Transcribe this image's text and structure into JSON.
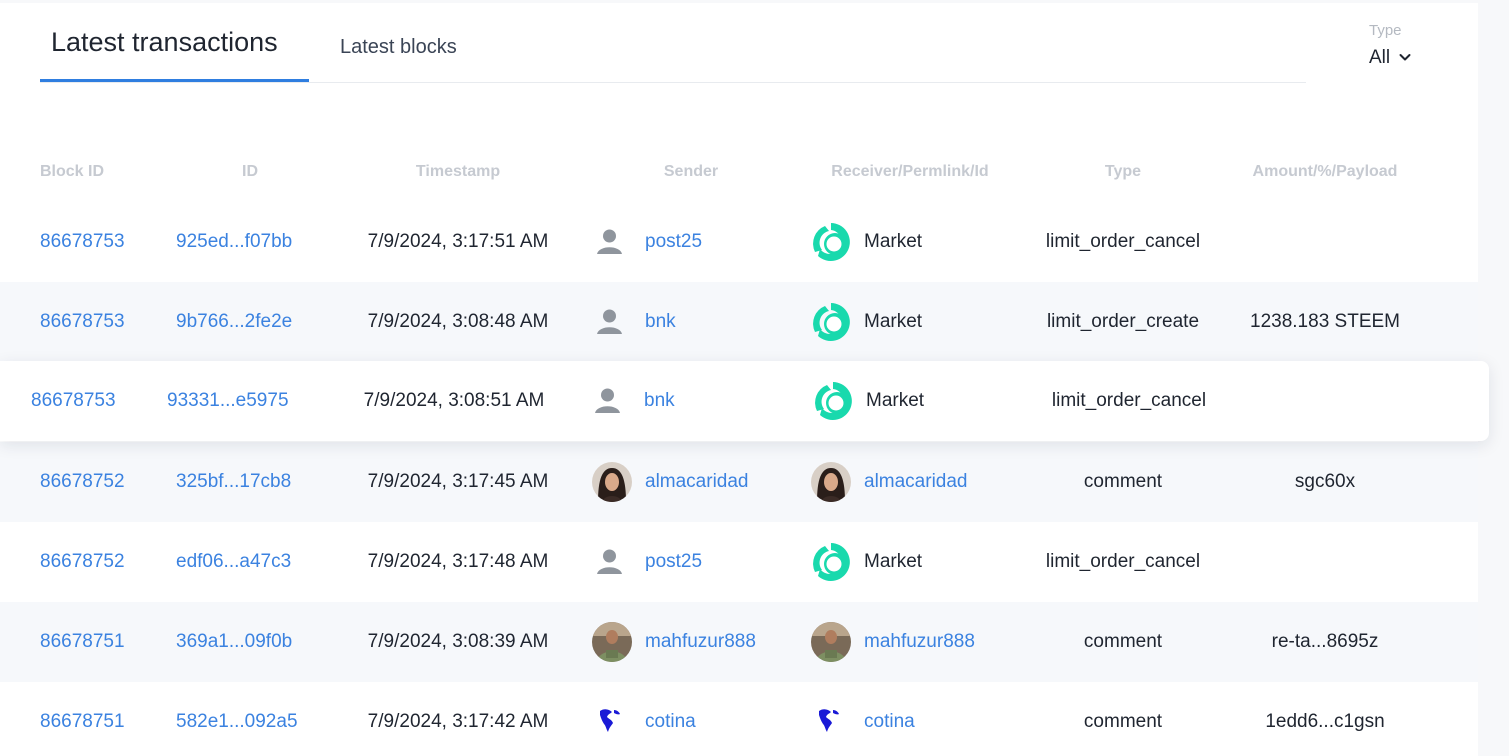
{
  "tabs": {
    "latest_transactions": "Latest transactions",
    "latest_blocks": "Latest blocks"
  },
  "filter": {
    "label": "Type",
    "value": "All"
  },
  "columns": [
    "Block ID",
    "ID",
    "Timestamp",
    "Sender",
    "Receiver/Permlink/Id",
    "Type",
    "Amount/%/Payload"
  ],
  "rows": [
    {
      "block": "86678753",
      "id": "925ed...f07bb",
      "time": "7/9/2024, 3:17:51 AM",
      "sender": "post25",
      "sender_avatar": "default-user-icon",
      "receiver": "Market",
      "receiver_avatar": "market-logo-icon",
      "receiver_link": false,
      "type": "limit_order_cancel",
      "payload": ""
    },
    {
      "block": "86678753",
      "id": "9b766...2fe2e",
      "time": "7/9/2024, 3:08:48 AM",
      "sender": "bnk",
      "sender_avatar": "default-user-icon",
      "receiver": "Market",
      "receiver_avatar": "market-logo-icon",
      "receiver_link": false,
      "type": "limit_order_create",
      "payload": "1238.183 STEEM"
    },
    {
      "block": "86678753",
      "id": "93331...e5975",
      "time": "7/9/2024, 3:08:51 AM",
      "sender": "bnk",
      "sender_avatar": "default-user-icon",
      "receiver": "Market",
      "receiver_avatar": "market-logo-icon",
      "receiver_link": false,
      "type": "limit_order_cancel",
      "payload": ""
    },
    {
      "block": "86678752",
      "id": "325bf...17cb8",
      "time": "7/9/2024, 3:17:45 AM",
      "sender": "almacaridad",
      "sender_avatar": "woman-photo-avatar",
      "receiver": "almacaridad",
      "receiver_avatar": "woman-photo-avatar",
      "receiver_link": true,
      "type": "comment",
      "payload": "sgc60x"
    },
    {
      "block": "86678752",
      "id": "edf06...a47c3",
      "time": "7/9/2024, 3:17:48 AM",
      "sender": "post25",
      "sender_avatar": "default-user-icon",
      "receiver": "Market",
      "receiver_avatar": "market-logo-icon",
      "receiver_link": false,
      "type": "limit_order_cancel",
      "payload": ""
    },
    {
      "block": "86678751",
      "id": "369a1...09f0b",
      "time": "7/9/2024, 3:08:39 AM",
      "sender": "mahfuzur888",
      "sender_avatar": "man-photo-avatar",
      "receiver": "mahfuzur888",
      "receiver_avatar": "man-photo-avatar",
      "receiver_link": true,
      "type": "comment",
      "payload": "re-ta...8695z"
    },
    {
      "block": "86678751",
      "id": "582e1...092a5",
      "time": "7/9/2024, 3:17:42 AM",
      "sender": "cotina",
      "sender_avatar": "globe-americas-icon",
      "receiver": "cotina",
      "receiver_avatar": "globe-americas-icon",
      "receiver_link": true,
      "type": "comment",
      "payload": "1edd6...c1gsn"
    }
  ],
  "colors": {
    "accent": "#3b82e0",
    "market": "#19d9ad",
    "header_text": "#c6cad1",
    "row_alt": "#f6f8fb"
  }
}
